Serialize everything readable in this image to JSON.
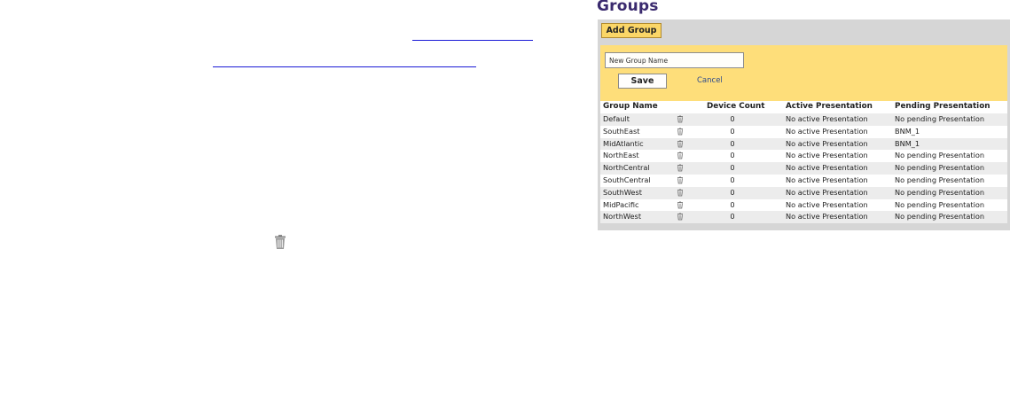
{
  "left_area": {
    "trash_icon": "trash-icon"
  },
  "groups": {
    "title": "Groups",
    "add_button_label": "Add Group",
    "form": {
      "name_value": "New Group Name",
      "save_label": "Save",
      "cancel_label": "Cancel"
    },
    "table": {
      "headers": {
        "name": "Group Name",
        "device_count": "Device Count",
        "active": "Active Presentation",
        "pending": "Pending Presentation"
      },
      "rows": [
        {
          "name": "Default",
          "count": "0",
          "active": "No active Presentation",
          "pending": "No pending Presentation"
        },
        {
          "name": "SouthEast",
          "count": "0",
          "active": "No active Presentation",
          "pending": "BNM_1"
        },
        {
          "name": "MidAtlantic",
          "count": "0",
          "active": "No active Presentation",
          "pending": "BNM_1"
        },
        {
          "name": "NorthEast",
          "count": "0",
          "active": "No active Presentation",
          "pending": "No pending Presentation"
        },
        {
          "name": "NorthCentral",
          "count": "0",
          "active": "No active Presentation",
          "pending": "No pending Presentation"
        },
        {
          "name": "SouthCentral",
          "count": "0",
          "active": "No active Presentation",
          "pending": "No pending Presentation"
        },
        {
          "name": "SouthWest",
          "count": "0",
          "active": "No active Presentation",
          "pending": "No pending Presentation"
        },
        {
          "name": "MidPacific",
          "count": "0",
          "active": "No active Presentation",
          "pending": "No pending Presentation"
        },
        {
          "name": "NorthWest",
          "count": "0",
          "active": "No active Presentation",
          "pending": "No pending Presentation"
        }
      ]
    }
  },
  "colors": {
    "title": "#3a2a6e",
    "panel": "#d6d6d6",
    "form_bg": "#fede7a",
    "button_bg": "#fbd667",
    "link_underline": "#1a1ad6"
  }
}
